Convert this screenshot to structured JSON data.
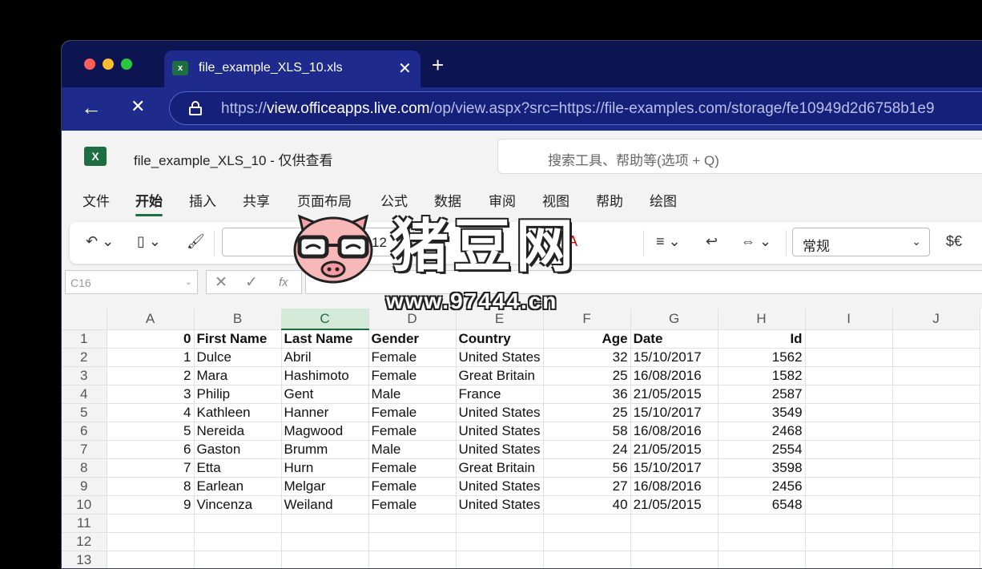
{
  "browser": {
    "tab_title": "file_example_XLS_10.xls",
    "url_prefix": "https://",
    "url_host": "view.officeapps.live.com",
    "url_path": "/op/view.aspx?src=https://file-examples.com/storage/fe10949d2d6758b1e9",
    "dots": [
      "#ff5f57",
      "#febc2e",
      "#28c840"
    ]
  },
  "app": {
    "file_title": "file_example_XLS_10 - 仅供查看",
    "search_placeholder": "搜索工具、帮助等(选项 + Q)"
  },
  "menu": [
    "文件",
    "开始",
    "插入",
    "共享",
    "页面布局",
    "公式",
    "数据",
    "审阅",
    "视图",
    "帮助",
    "绘图"
  ],
  "toolbar": {
    "font_name": "",
    "font_size": "12",
    "bold": "B",
    "number_format": "常规",
    "currency": "$€"
  },
  "formula": {
    "name_box": "C16",
    "fx": "fx",
    "cancel": "✕",
    "confirm": "✓"
  },
  "sheet": {
    "columns": [
      "A",
      "B",
      "C",
      "D",
      "E",
      "F",
      "G",
      "H",
      "I",
      "J"
    ],
    "rows": [
      [
        "1",
        "0",
        "First Name",
        "Last Name",
        "Gender",
        "Country",
        "Age",
        "Date",
        "Id",
        "",
        ""
      ],
      [
        "2",
        "1",
        "Dulce",
        "Abril",
        "Female",
        "United States",
        "32",
        "15/10/2017",
        "1562",
        "",
        ""
      ],
      [
        "3",
        "2",
        "Mara",
        "Hashimoto",
        "Female",
        "Great Britain",
        "25",
        "16/08/2016",
        "1582",
        "",
        ""
      ],
      [
        "4",
        "3",
        "Philip",
        "Gent",
        "Male",
        "France",
        "36",
        "21/05/2015",
        "2587",
        "",
        ""
      ],
      [
        "5",
        "4",
        "Kathleen",
        "Hanner",
        "Female",
        "United States",
        "25",
        "15/10/2017",
        "3549",
        "",
        ""
      ],
      [
        "6",
        "5",
        "Nereida",
        "Magwood",
        "Female",
        "United States",
        "58",
        "16/08/2016",
        "2468",
        "",
        ""
      ],
      [
        "7",
        "6",
        "Gaston",
        "Brumm",
        "Male",
        "United States",
        "24",
        "21/05/2015",
        "2554",
        "",
        ""
      ],
      [
        "8",
        "7",
        "Etta",
        "Hurn",
        "Female",
        "Great Britain",
        "56",
        "15/10/2017",
        "3598",
        "",
        ""
      ],
      [
        "9",
        "8",
        "Earlean",
        "Melgar",
        "Female",
        "United States",
        "27",
        "16/08/2016",
        "2456",
        "",
        ""
      ],
      [
        "10",
        "9",
        "Vincenza",
        "Weiland",
        "Female",
        "United States",
        "40",
        "21/05/2015",
        "6548",
        "",
        ""
      ],
      [
        "11",
        "",
        "",
        "",
        "",
        "",
        "",
        "",
        "",
        "",
        ""
      ],
      [
        "12",
        "",
        "",
        "",
        "",
        "",
        "",
        "",
        "",
        "",
        ""
      ],
      [
        "13",
        "",
        "",
        "",
        "",
        "",
        "",
        "",
        "",
        "",
        ""
      ]
    ]
  },
  "watermark": {
    "title": "猪豆网",
    "url": "www.97444.cn"
  }
}
